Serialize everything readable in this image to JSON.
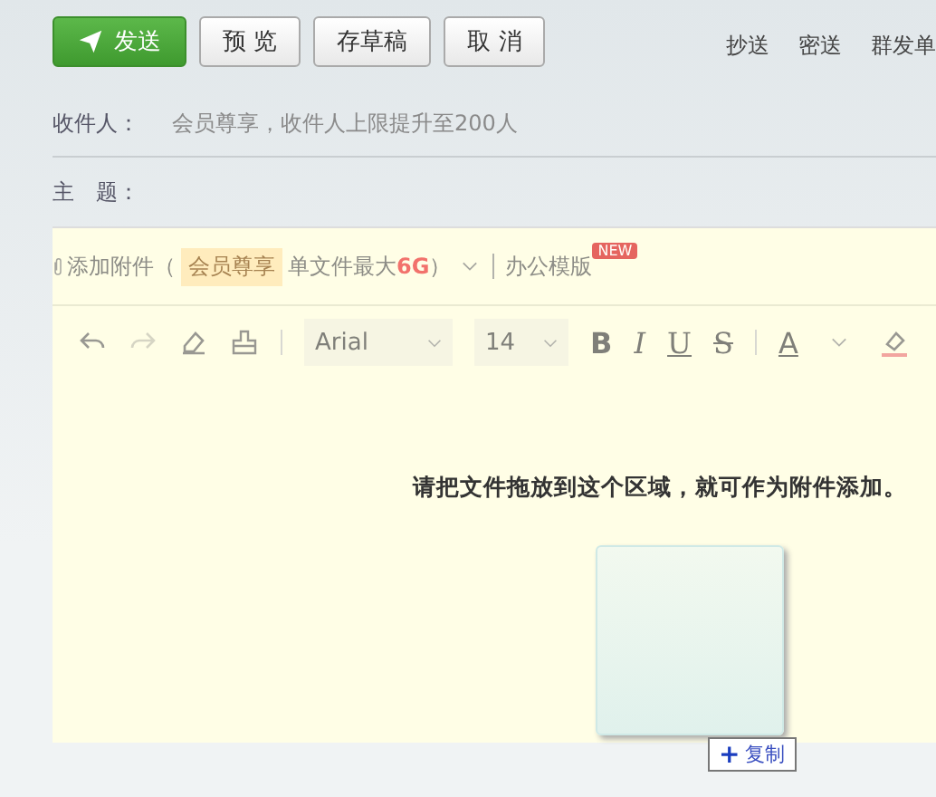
{
  "actions": [
    {
      "label": "发送",
      "kind": "primary"
    },
    {
      "label": "预 览",
      "kind": "plain"
    },
    {
      "label": "存草稿",
      "kind": "plain"
    },
    {
      "label": "取 消",
      "kind": "plain"
    }
  ],
  "header_links": [
    "抄送",
    "密送",
    "群发单"
  ],
  "recipients": {
    "label": "收件人：",
    "placeholder": "会员尊享，收件人上限提升至200人"
  },
  "subject": {
    "label": "主　题："
  },
  "attachment": {
    "label": "添加附件（",
    "badge": "会员尊享",
    "note": "单文件最大**6G**）",
    "template": "办公模版",
    "new_badge": "NEW"
  },
  "toolbar": {
    "font": "Arial",
    "size": "14",
    "format_buttons": [
      {
        "label": "B",
        "kind": "bold"
      },
      {
        "label": "I",
        "kind": "italic"
      },
      {
        "label": "U",
        "kind": "underline"
      },
      {
        "label": "S",
        "kind": "strike"
      }
    ],
    "color_label": "A"
  },
  "drop_zone": {
    "message": "请把文件拖放到这个区域，就可作为附件添加。"
  },
  "drag_tooltip": {
    "icon": "+",
    "label": "复制"
  }
}
